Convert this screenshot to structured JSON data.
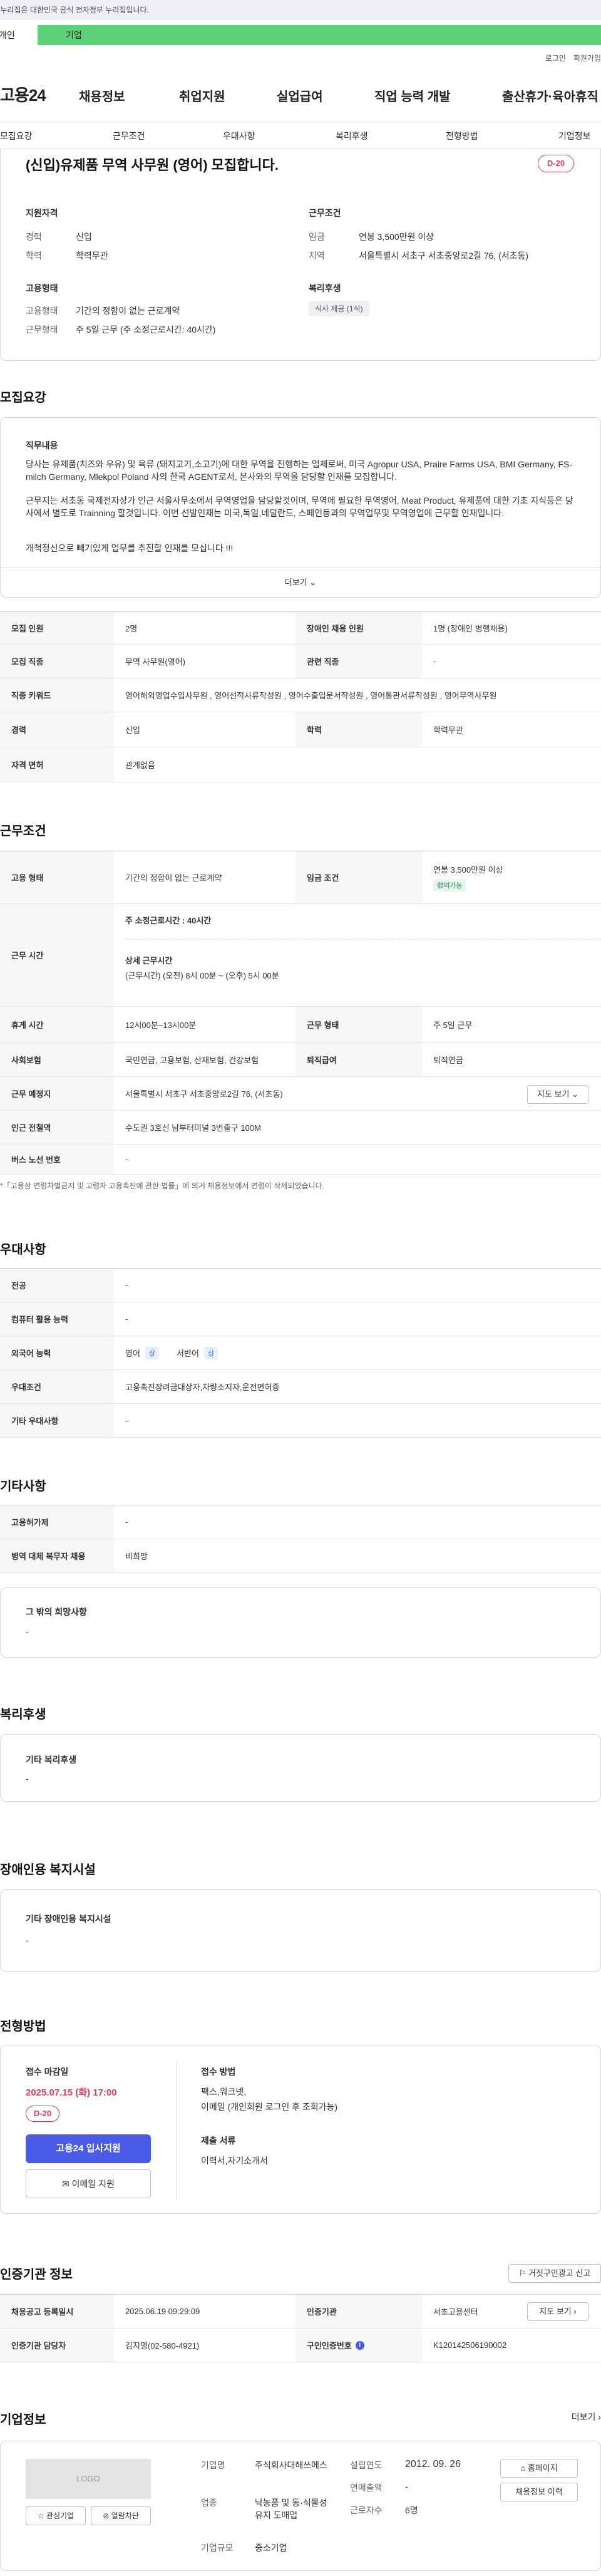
{
  "gov_banner": "이 누리집은 대한민국 공식 전자정부 누리집입니다.",
  "tabs": {
    "individual": "개인",
    "business": "기업"
  },
  "util": {
    "login": "로그인",
    "join": "회원가입"
  },
  "gnb": {
    "logo": "고용24",
    "items": [
      "채용정보",
      "취업지원",
      "실업급여",
      "직업 능력 개발",
      "출산휴가·육아휴직"
    ]
  },
  "subnav": [
    "모집요강",
    "근무조건",
    "우대사항",
    "복리후생",
    "전형방법",
    "기업정보"
  ],
  "summary": {
    "title": "(신입)유제품 무역 사무원 (영어) 모집합니다.",
    "dday": "D-20",
    "qual_title": "지원자격",
    "qual_rows": [
      {
        "k": "경력",
        "v": "신입"
      },
      {
        "k": "학력",
        "v": "학력무관"
      }
    ],
    "cond_title": "근무조건",
    "cond_rows": [
      {
        "k": "임금",
        "v": "연봉 3,500만원 이상"
      },
      {
        "k": "지역",
        "v": "서울특별시 서초구 서초중앙로2길 76, (서초동)"
      }
    ],
    "emp_title": "고용형태",
    "emp_rows": [
      {
        "k": "고용형태",
        "v": "기간의 정함이 없는 근로계약"
      },
      {
        "k": "근무형태",
        "v": "주 5일 근무 (주 소정근로시간: 40시간)"
      }
    ],
    "welfare_title": "복리후생",
    "welfare_chip": "식사 제공 (1식)"
  },
  "recruit": {
    "title": "모집요강",
    "duty_title": "직무내용",
    "duty_p1": "당사는 유제품(치즈와 우유) 및 육류 (돼지고기,소고기)에 대한 무역을 진행하는 업체로써, 미국 Agropur USA, Praire Farms USA, BMI Germany, FS-milch Germany, Mlekpol Poland 사의 한국 AGENT로서, 본사와의 무역을 담당할 인재를 모집합니다.",
    "duty_p2": "근무지는 서초동 국제전자상가 인근 서울사무소에서 무역영업을 담당할것이며, 무역에 필요한 무역영어, Meat Product, 유제품에 대한 기초 지식등은 당사에서 별도로  Trainning 할것입니다. 이번 선발인재는 미국,독일,네덜란드, 스페인등과의 무역업무및 무역영업에 근무할 인재입니다.",
    "duty_p3": "개척정신으로 빼기있게 업무를 추진할 인재를 모십니다 !!!",
    "more": "더보기",
    "rows": [
      {
        "k1": "모집 인원",
        "v1": "2명",
        "k2": "장애인 채용 인원",
        "v2": "1명 (장애인 병행채용)"
      },
      {
        "k1": "모집 직종",
        "v1": "무역 사무원(영어)",
        "k2": "관련 직종",
        "v2": "-"
      },
      {
        "k1": "직종 키워드",
        "v1": "영어해외영업수입사무원 , 영어선적사류작성원 , 영어수출입문서작성원 , 영어통관서류작성원 , 영어무역사무원",
        "k2": "",
        "v2": ""
      },
      {
        "k1": "경력",
        "v1": "신입",
        "k2": "학력",
        "v2": "학력무관"
      },
      {
        "k1": "자격 면허",
        "v1": "관계없음",
        "k2": "",
        "v2": ""
      }
    ]
  },
  "work": {
    "title": "근무조건",
    "emp_k": "고용 형태",
    "emp_v": "기간의 정함이 없는 근로계약",
    "pay_k": "임금 조건",
    "pay_v": "연봉 3,500만원 이상",
    "pay_tag": "협의가능",
    "hours_k": "근무 시간",
    "hours_weekly": "주 소정근로시간 : 40시간",
    "hours_detail_title": "상세 근무시간",
    "hours_detail": "(근무시간) (오전) 8시 00분 ~ (오후) 5시 00분",
    "break_k": "휴게 시간",
    "break_v": "12시00분~13시00분",
    "shift_k": "근무 형태",
    "shift_v": "주 5일 근무",
    "ins_k": "사회보험",
    "ins_v": "국민연금, 고용보험, 산재보험, 건강보험",
    "sev_k": "퇴직급여",
    "sev_v": "퇴직연금",
    "place_k": "근무 예정지",
    "place_v": "서울특별시 서초구 서초중앙로2길 76, (서초동)",
    "map_btn": "지도 보기",
    "subway_k": "인근 전철역",
    "subway_v": "수도권 3호선 남부터미널 3번출구 100M",
    "bus_k": "버스 노선 번호",
    "bus_v": "-",
    "note": "*「고용상 연령차별금지 및 고령자 고용촉진에 관한 법률」에 의거 채용정보에서 연령이 삭제되었습니다."
  },
  "pref": {
    "title": "우대사항",
    "rows": [
      {
        "k": "전공",
        "v": "-"
      },
      {
        "k": "컴퓨터 활용 능력",
        "v": "-"
      },
      {
        "k": "외국어 능력",
        "v": "영어",
        "tag": "상",
        "v2": "서반어",
        "tag2": "상"
      },
      {
        "k": "우대조건",
        "v": "고용촉진장려금대상자,차량소지자,운전면허증"
      },
      {
        "k": "기타 우대사항",
        "v": "-"
      }
    ]
  },
  "etc": {
    "title": "기타사항",
    "rows": [
      {
        "k": "고용허가제",
        "v": "-"
      },
      {
        "k": "병역 대체 복무자 채용",
        "v": "비희망"
      }
    ],
    "other_title": "그 밖의 희망사항",
    "other_v": "-"
  },
  "welfare": {
    "title": "복리후생",
    "box_title": "기타 복리후생",
    "box_v": "-"
  },
  "disabled": {
    "title": "장애인용 복지시설",
    "box_title": "기타 장애인용 복지시설",
    "box_v": "-"
  },
  "process": {
    "title": "전형방법",
    "deadline_title": "접수 마감일",
    "deadline": "2025.07.15 (화) 17:00",
    "dday": "D-20",
    "apply_btn": "고용24 입사지원",
    "email_btn": "이메일 지원",
    "method_title": "접수 방법",
    "method_v1": "팩스,워크넷,",
    "method_v2": "이메일 (개인회원 로그인 후 조회가능)",
    "docs_title": "제출 서류",
    "docs_v": "이력서,자기소개서"
  },
  "cert": {
    "title": "인증기관 정보",
    "report_btn": "거짓구인광고 신고",
    "r1k1": "채용공고 등록일시",
    "r1v1": "2025.06.19 09:29:09",
    "r1k2": "인증기관",
    "r1v2": "서초고용센터",
    "map_btn": "지도 보기",
    "r2k1": "인증기관 담당자",
    "r2v1": "김지영(02-580-4921)",
    "r2k2": "구인인증번호",
    "r2v2": "K120142506190002"
  },
  "company": {
    "title": "기업정보",
    "more": "더보기",
    "logo_text": "LOGO",
    "fav_btn": "관심기업",
    "block_btn": "열람차단",
    "name_k": "기업명",
    "name_v": "주식회사대해쓰에스",
    "biz_k": "업종",
    "biz_v": "낙농품 및 동·식물성 유지 도매업",
    "size_k": "기업규모",
    "size_v": "중소기업",
    "est_k": "설립연도",
    "est_v": "2012. 09. 26",
    "sales_k": "연매출액",
    "sales_v": "-",
    "emp_k": "근로자수",
    "emp_v": "6명",
    "home_btn": "홈페이지",
    "jobs_btn": "채용정보 이력"
  }
}
